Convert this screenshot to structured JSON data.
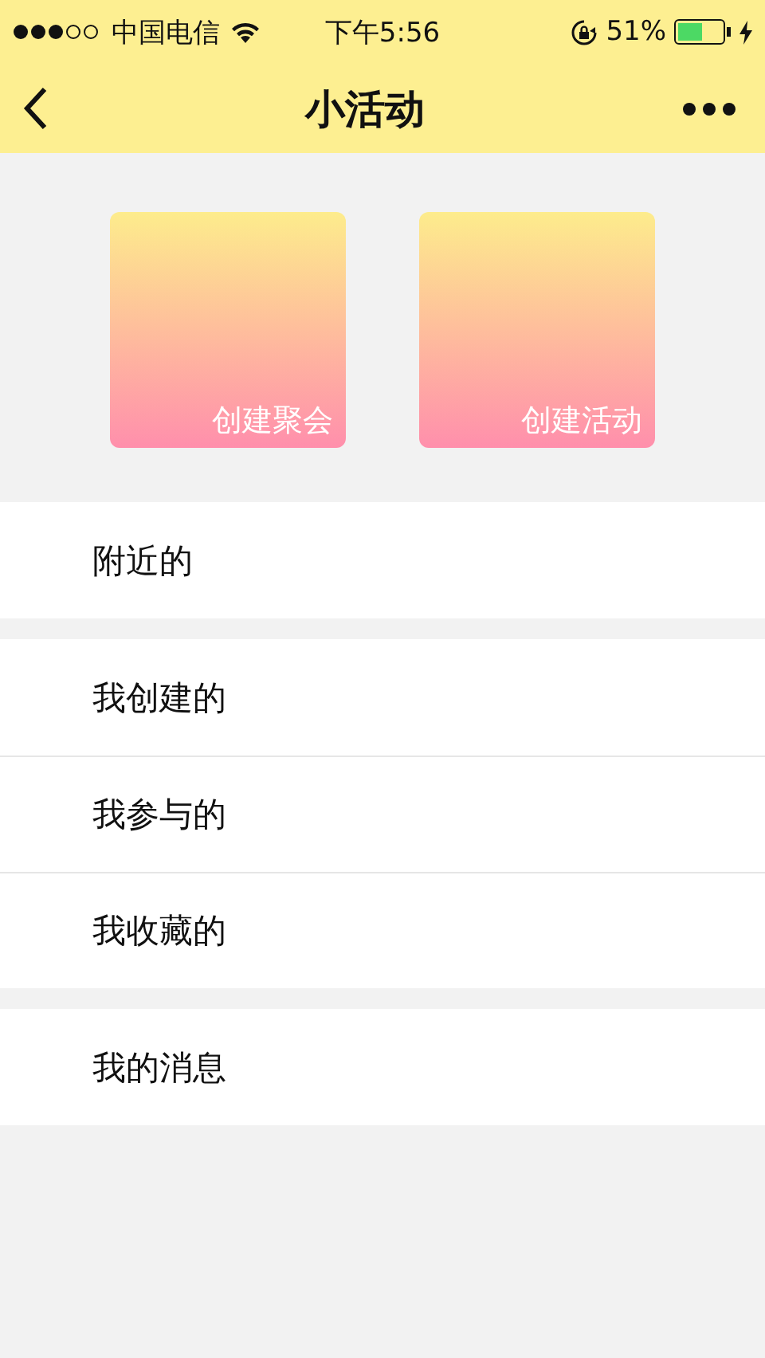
{
  "status_bar": {
    "carrier": "中国电信",
    "time": "下午5:56",
    "battery": "51%"
  },
  "nav": {
    "title": "小活动"
  },
  "actions": [
    {
      "label": "创建聚会"
    },
    {
      "label": "创建活动"
    }
  ],
  "menu_groups": [
    {
      "items": [
        {
          "label": "附近的"
        }
      ]
    },
    {
      "items": [
        {
          "label": "我创建的"
        },
        {
          "label": "我参与的"
        },
        {
          "label": "我收藏的"
        }
      ]
    },
    {
      "items": [
        {
          "label": "我的消息"
        }
      ]
    }
  ]
}
